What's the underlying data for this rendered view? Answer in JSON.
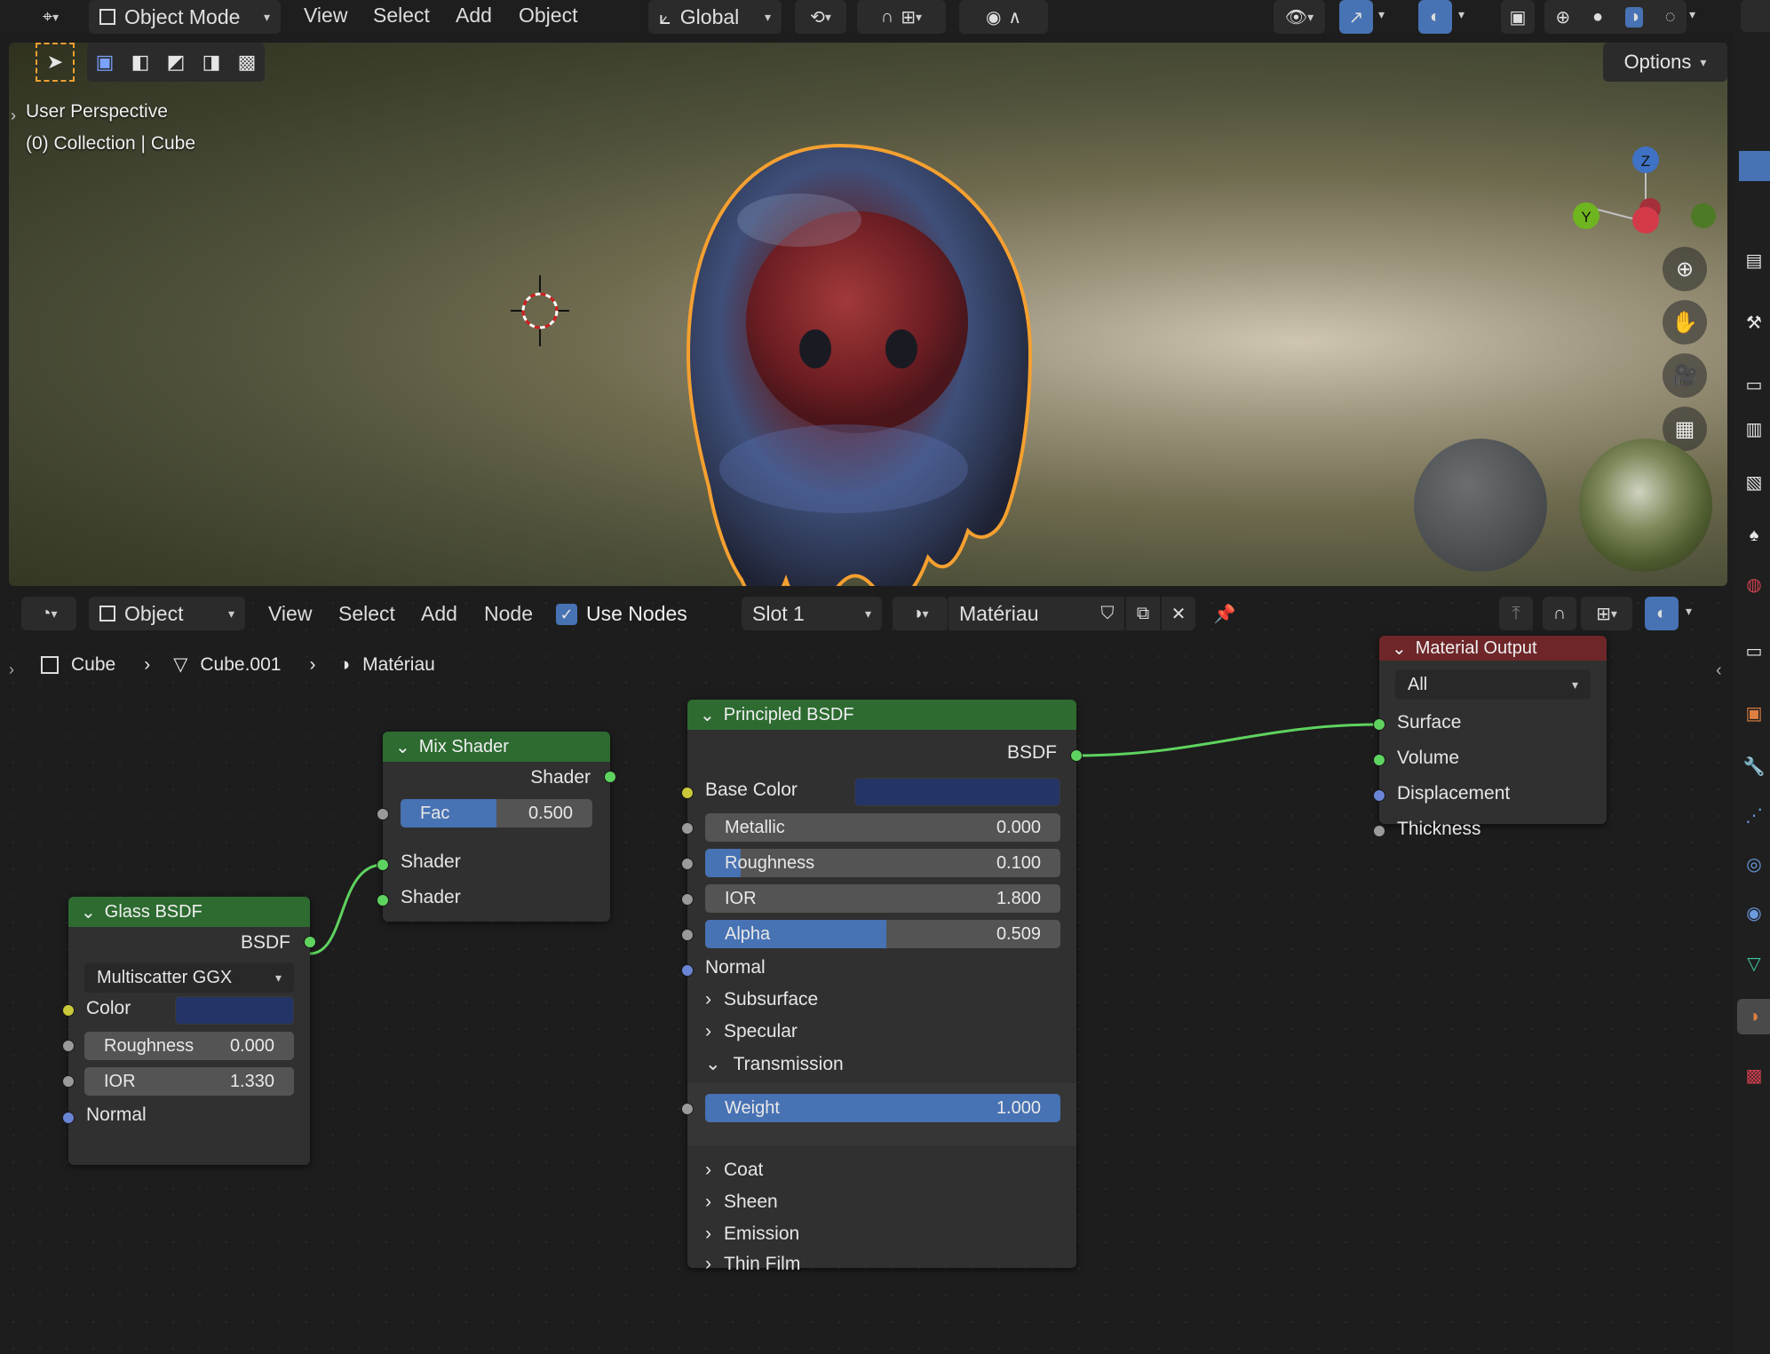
{
  "viewport_header": {
    "editor_type_icon": "viewport-icon",
    "mode": "Object Mode",
    "menus": [
      "View",
      "Select",
      "Add",
      "Object"
    ],
    "transform_orientation": "Global",
    "options": "Options"
  },
  "viewport": {
    "perspective": "User Perspective",
    "collection": "(0) Collection | Cube",
    "gizmo": {
      "z": "Z",
      "y": "Y"
    }
  },
  "node_header": {
    "editor_type_icon": "shader-editor-icon",
    "object_type": "Object",
    "menus": [
      "View",
      "Select",
      "Add",
      "Node"
    ],
    "use_nodes": "Use Nodes",
    "slot": "Slot 1",
    "material": "Matériau"
  },
  "breadcrumb": {
    "object": "Cube",
    "mesh": "Cube.001",
    "material": "Matériau"
  },
  "nodes": {
    "glass": {
      "title": "Glass BSDF",
      "output": "BSDF",
      "distribution": "Multiscatter GGX",
      "color_label": "Color",
      "roughness_label": "Roughness",
      "roughness_value": "0.000",
      "ior_label": "IOR",
      "ior_value": "1.330",
      "normal_label": "Normal",
      "color": "#243466"
    },
    "mix": {
      "title": "Mix Shader",
      "output": "Shader",
      "fac_label": "Fac",
      "fac_value": "0.500",
      "fac_fraction": 0.5,
      "input1": "Shader",
      "input2": "Shader"
    },
    "principled": {
      "title": "Principled BSDF",
      "output": "BSDF",
      "base_color_label": "Base Color",
      "base_color": "#243466",
      "metallic_label": "Metallic",
      "metallic_value": "0.000",
      "roughness_label": "Roughness",
      "roughness_value": "0.100",
      "roughness_fraction": 0.1,
      "ior_label": "IOR",
      "ior_value": "1.800",
      "alpha_label": "Alpha",
      "alpha_value": "0.509",
      "alpha_fraction": 0.509,
      "normal_label": "Normal",
      "subsurface": "Subsurface",
      "specular": "Specular",
      "transmission": "Transmission",
      "weight_label": "Weight",
      "weight_value": "1.000",
      "weight_fraction": 1.0,
      "coat": "Coat",
      "sheen": "Sheen",
      "emission": "Emission",
      "thin_film": "Thin Film"
    },
    "output": {
      "title": "Material Output",
      "target": "All",
      "surface": "Surface",
      "volume": "Volume",
      "displacement": "Displacement",
      "thickness": "Thickness"
    }
  },
  "colors": {
    "accent": "#4772b3",
    "node_header_shader": "#2d6b31",
    "node_header_output": "#6e2629",
    "link": "#5fd35f",
    "selection_outline": "#f5a030"
  }
}
